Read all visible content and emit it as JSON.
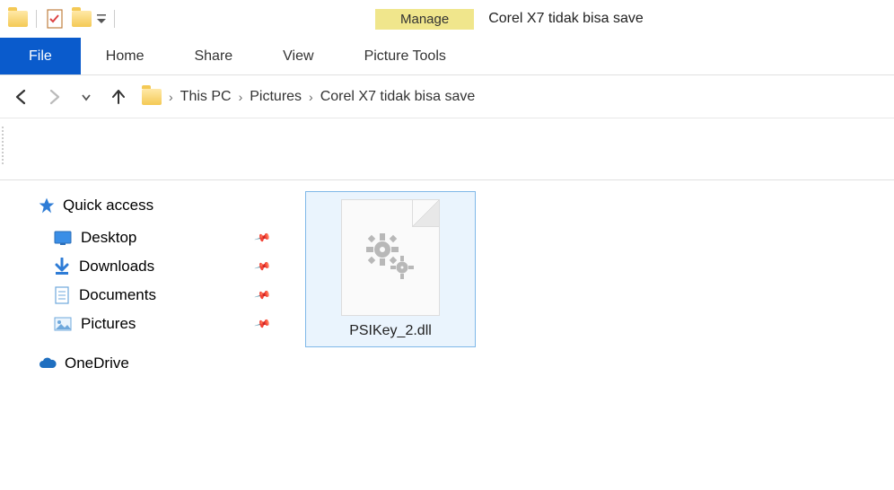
{
  "window": {
    "title": "Corel X7 tidak bisa save",
    "contextual_tab_header": "Manage"
  },
  "ribbon": {
    "file": "File",
    "home": "Home",
    "share": "Share",
    "view": "View",
    "context": "Picture Tools"
  },
  "breadcrumb": {
    "items": [
      "This PC",
      "Pictures",
      "Corel X7 tidak bisa save"
    ]
  },
  "nav": {
    "quick_access": "Quick access",
    "desktop": "Desktop",
    "downloads": "Downloads",
    "documents": "Documents",
    "pictures": "Pictures",
    "onedrive": "OneDrive"
  },
  "content": {
    "files": [
      {
        "name": "PSIKey_2.dll"
      }
    ]
  }
}
